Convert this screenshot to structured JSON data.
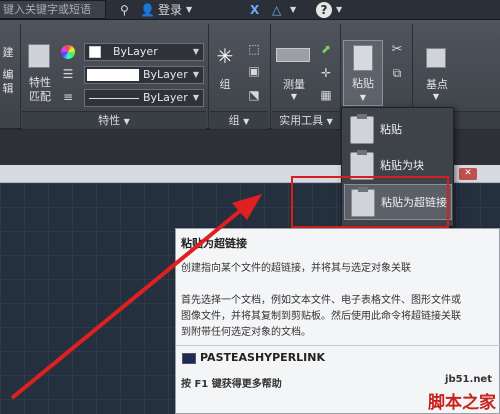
{
  "topbar": {
    "search_placeholder": "键入关键字或短语",
    "login_label": "登录",
    "help_label": "?"
  },
  "ribbon": {
    "left_labels": [
      "建",
      "编辑"
    ],
    "properties": {
      "match_label": "特性\n匹配",
      "match_line1": "特性",
      "match_line2": "匹配",
      "color_value": "ByLayer",
      "linetype_value": "ByLayer",
      "lineweight_value": "ByLayer",
      "panel_title": "特性"
    },
    "group": {
      "group_label": "组",
      "panel_title": "组"
    },
    "utilities": {
      "measure_label": "测量",
      "panel_title": "实用工具"
    },
    "clipboard": {
      "paste_label": "粘贴"
    },
    "base": {
      "base_label": "基点"
    }
  },
  "paste_menu": {
    "items": [
      {
        "label": "粘贴"
      },
      {
        "label": "粘贴为块"
      },
      {
        "label": "粘贴为超链接"
      }
    ]
  },
  "tooltip": {
    "title": "粘贴为超链接",
    "line1": "创建指向某个文件的超链接，并将其与选定对象关联",
    "line2": "首先选择一个文档，例如文本文件、电子表格文件、图形文件或",
    "line3": "图像文件，并将其复制到剪贴板。然后使用此命令将超链接关联",
    "line4": "到附带任何选定对象的文档。",
    "command": "PASTEASHYPERLINK",
    "help": "按 F1 键获得更多帮助"
  },
  "watermark": {
    "url": "jb51.net",
    "text": "脚本之家"
  },
  "colors": {
    "highlight_box": "#d81e1e",
    "arrow": "#e02020"
  }
}
